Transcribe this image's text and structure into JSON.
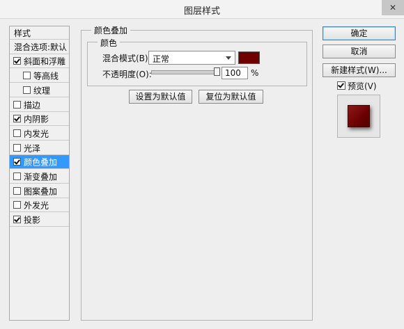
{
  "window": {
    "title": "图层样式",
    "close_label": "✕"
  },
  "style_list": {
    "header": "样式",
    "blend_options": "混合选项:默认",
    "items": [
      {
        "label": "斜面和浮雕",
        "checked": true,
        "sub": false,
        "selected": false
      },
      {
        "label": "等高线",
        "checked": false,
        "sub": true,
        "selected": false
      },
      {
        "label": "纹理",
        "checked": false,
        "sub": true,
        "selected": false
      },
      {
        "label": "描边",
        "checked": false,
        "sub": false,
        "selected": false
      },
      {
        "label": "内阴影",
        "checked": true,
        "sub": false,
        "selected": false
      },
      {
        "label": "内发光",
        "checked": false,
        "sub": false,
        "selected": false
      },
      {
        "label": "光泽",
        "checked": false,
        "sub": false,
        "selected": false
      },
      {
        "label": "颜色叠加",
        "checked": true,
        "sub": false,
        "selected": true
      },
      {
        "label": "渐变叠加",
        "checked": false,
        "sub": false,
        "selected": false
      },
      {
        "label": "图案叠加",
        "checked": false,
        "sub": false,
        "selected": false
      },
      {
        "label": "外发光",
        "checked": false,
        "sub": false,
        "selected": false
      },
      {
        "label": "投影",
        "checked": true,
        "sub": false,
        "selected": false
      }
    ]
  },
  "panel": {
    "title": "颜色叠加",
    "group_title": "颜色",
    "blend_mode_label": "混合模式(B):",
    "blend_mode_value": "正常",
    "overlay_color": "#6e0000",
    "opacity_label": "不透明度(O):",
    "opacity_value": "100",
    "opacity_unit": "%",
    "opacity_fraction": 1.0,
    "make_default": "设置为默认值",
    "reset_default": "复位为默认值"
  },
  "buttons": {
    "ok": "确定",
    "cancel": "取消",
    "new_style": "新建样式(W)...",
    "preview_label": "预览(V)",
    "preview_checked": true
  },
  "colors": {
    "selection": "#3399ff",
    "preview_fill": "#6c0000"
  }
}
